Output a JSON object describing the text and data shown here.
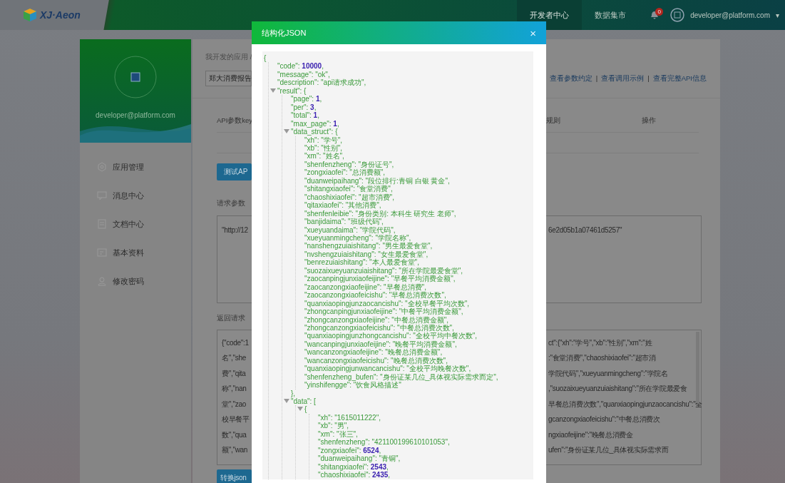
{
  "header": {
    "logo_text": "XJ·Aeon",
    "nav": [
      {
        "label": "开发者中心",
        "selected": true
      },
      {
        "label": "数据集市",
        "selected": false
      }
    ],
    "notification_count": "0",
    "user_email": "developer@platform.com",
    "caret": "▾"
  },
  "sidebar": {
    "email": "developer@platform.com",
    "items": [
      {
        "label": "应用管理",
        "kind": "settings"
      },
      {
        "label": "消息中心",
        "kind": "messages"
      },
      {
        "label": "文档中心",
        "kind": "documents"
      },
      {
        "label": "基本资料",
        "kind": "profile"
      },
      {
        "label": "修改密码",
        "kind": "password"
      }
    ]
  },
  "main": {
    "breadcrumb": "我开发的应用 /",
    "app_select": "郑大消费报告",
    "links": [
      {
        "label": "查看参数约定",
        "separator": "|"
      },
      {
        "label": "查看调用示例",
        "separator": "|"
      },
      {
        "label": "查看完整API信息"
      }
    ],
    "param_columns": [
      "API参数key",
      "规则",
      "操作"
    ],
    "test_button": "测试AP",
    "request_label": "请求参数",
    "request_text": {
      "left": "\"http://12",
      "right": "6e2d05b1a07461d5257\""
    },
    "response_label": "返回请求",
    "response_lines": [
      {
        "left": "{\"code\":1",
        "right": "ct\":{\"xh\":\"学号\",\"xb\":\"性别\",\"xm\":\"姓"
      },
      {
        "left": "名\",\"she",
        "right": ":\"食堂消费\",\"chaoshixiaofei\":\"超市消"
      },
      {
        "left": "费\",\"qita",
        "right": "学院代码\",\"xueyuanmingcheng\":\"学院名"
      },
      {
        "left": "称\",\"nan",
        "right": ",\"suozaixueyuanzuiaishitang\":\"所在学院最爱食"
      },
      {
        "left": "堂\",\"zao",
        "right": "早餐总消费次数\",\"quanxiaopingjunzaocancishu\":\"全"
      },
      {
        "left": "校早餐平",
        "right": "gcanzongxiaofeicishu\":\"中餐总消费次"
      },
      {
        "left": "数\",\"qua",
        "right": "ngxiaofeijine\":\"晚餐总消费金"
      },
      {
        "left": "额\",\"wan",
        "right": "ufen\":\"身份证某几位_具体视实际需求而"
      }
    ],
    "convert_button": "转换json"
  },
  "modal": {
    "title": "结构化JSON",
    "close": "×",
    "json": {
      "open": "{",
      "children": [
        {
          "kind": "number",
          "key": "\"code\": ",
          "value": "10000",
          "tail": ","
        },
        {
          "kind": "string",
          "text": "\"message\": \"ok\","
        },
        {
          "kind": "string",
          "text": "\"description\": \"api请求成功\","
        },
        {
          "kind": "branch",
          "text": "\"result\": {",
          "expanded": true,
          "children": [
            {
              "kind": "number",
              "key": "\"page\": ",
              "value": "1",
              "tail": ","
            },
            {
              "kind": "number",
              "key": "\"per\": ",
              "value": "3",
              "tail": ","
            },
            {
              "kind": "number",
              "key": "\"total\": ",
              "value": "1",
              "tail": ","
            },
            {
              "kind": "number",
              "key": "\"max_page\": ",
              "value": "1",
              "tail": ","
            },
            {
              "kind": "branch",
              "text": "\"data_struct\": {",
              "expanded": true,
              "children": [
                {
                  "kind": "string",
                  "text": "\"xh\": \"学号\","
                },
                {
                  "kind": "string",
                  "text": "\"xb\": \"性别\","
                },
                {
                  "kind": "string",
                  "text": "\"xm\": \"姓名\","
                },
                {
                  "kind": "string",
                  "text": "\"shenfenzheng\": \"身份证号\","
                },
                {
                  "kind": "string",
                  "text": "\"zongxiaofei\": \"总消费额\","
                },
                {
                  "kind": "string",
                  "text": "\"duanweipaihang\": \"段位排行:青铜 白银 黄金\","
                },
                {
                  "kind": "string",
                  "text": "\"shitangxiaofei\": \"食堂消费\","
                },
                {
                  "kind": "string",
                  "text": "\"chaoshixiaofei\": \"超市消费\","
                },
                {
                  "kind": "string",
                  "text": "\"qitaxiaofei\": \"其他消费\","
                },
                {
                  "kind": "string",
                  "text": "\"shenfenleibie\": \"身份类别: 本科生 研究生 老师\","
                },
                {
                  "kind": "string",
                  "text": "\"banjidaima\": \"班级代码\","
                },
                {
                  "kind": "string",
                  "text": "\"xueyuandaima\": \"学院代码\","
                },
                {
                  "kind": "string",
                  "text": "\"xueyuanmingcheng\": \"学院名称\","
                },
                {
                  "kind": "string",
                  "text": "\"nanshengzuiaishitang\": \"男生最爱食堂\","
                },
                {
                  "kind": "string",
                  "text": "\"nvshengzuiaishitang\": \"女生最爱食堂\","
                },
                {
                  "kind": "string",
                  "text": "\"benrezuiaishitang\": \"本人最爱食堂\","
                },
                {
                  "kind": "string",
                  "text": "\"suozaixueyuanzuiaishitang\": \"所在学院最爱食堂\","
                },
                {
                  "kind": "string",
                  "text": "\"zaocanpingjunxiaofeijine\": \"早餐平均消费金额\","
                },
                {
                  "kind": "string",
                  "text": "\"zaocanzongxiaofeijine\": \"早餐总消费\","
                },
                {
                  "kind": "string",
                  "text": "\"zaocanzongxiaofeicishu\": \"早餐总消费次数\","
                },
                {
                  "kind": "string",
                  "text": "\"quanxiaopingjunzaocancishu\": \"全校早餐平均次数\","
                },
                {
                  "kind": "string",
                  "text": "\"zhongcanpingjunxiaofeijine\": \"中餐平均消费金额\","
                },
                {
                  "kind": "string",
                  "text": "\"zhongcanzongxiaofeijine\": \"中餐总消费金额\","
                },
                {
                  "kind": "string",
                  "text": "\"zhongcanzongxiaofeicishu\": \"中餐总消费次数\","
                },
                {
                  "kind": "string",
                  "text": "\"quanxiaopingjunzhongcancishu\": \"全校平均中餐次数\","
                },
                {
                  "kind": "string",
                  "text": "\"wancanpingjunxiaofeijine\": \"晚餐平均消费金额\","
                },
                {
                  "kind": "string",
                  "text": "\"wancanzongxiaofeijine\": \"晚餐总消费金额\","
                },
                {
                  "kind": "string",
                  "text": "\"wancanzongxiaofeicishu\": \"晚餐总消费次数\","
                },
                {
                  "kind": "string",
                  "text": "\"quanxiaopingjunwancancishu\": \"全校平均晚餐次数\","
                },
                {
                  "kind": "string",
                  "text": "\"shenfenzheng_bufen\": \"身份证某几位_具体视实际需求而定\","
                },
                {
                  "kind": "string",
                  "text": "\"yinshifengge\": \"饮食风格描述\""
                }
              ]
            },
            {
              "kind": "close",
              "text": "},"
            },
            {
              "kind": "branch",
              "text": "\"data\": [",
              "expanded": true,
              "children": [
                {
                  "kind": "branch",
                  "text": "{",
                  "expanded": true,
                  "children": [
                    {
                      "kind": "string",
                      "text": "\"xh\": \"1615011222\","
                    },
                    {
                      "kind": "string",
                      "text": "\"xb\": \"男\","
                    },
                    {
                      "kind": "string",
                      "text": "\"xm\": \"张三\","
                    },
                    {
                      "kind": "string",
                      "text": "\"shenfenzheng\": \"421100199610101053\","
                    },
                    {
                      "kind": "number",
                      "key": "\"zongxiaofei\": ",
                      "value": "6524",
                      "tail": ","
                    },
                    {
                      "kind": "string",
                      "text": "\"duanweipaihang\": \"青铜\","
                    },
                    {
                      "kind": "number",
                      "key": "\"shitangxiaofei\": ",
                      "value": "2543",
                      "tail": ","
                    },
                    {
                      "kind": "number",
                      "key": "\"chaoshixiaofei\": ",
                      "value": "2435",
                      "tail": ","
                    }
                  ]
                }
              ]
            }
          ]
        }
      ]
    }
  }
}
